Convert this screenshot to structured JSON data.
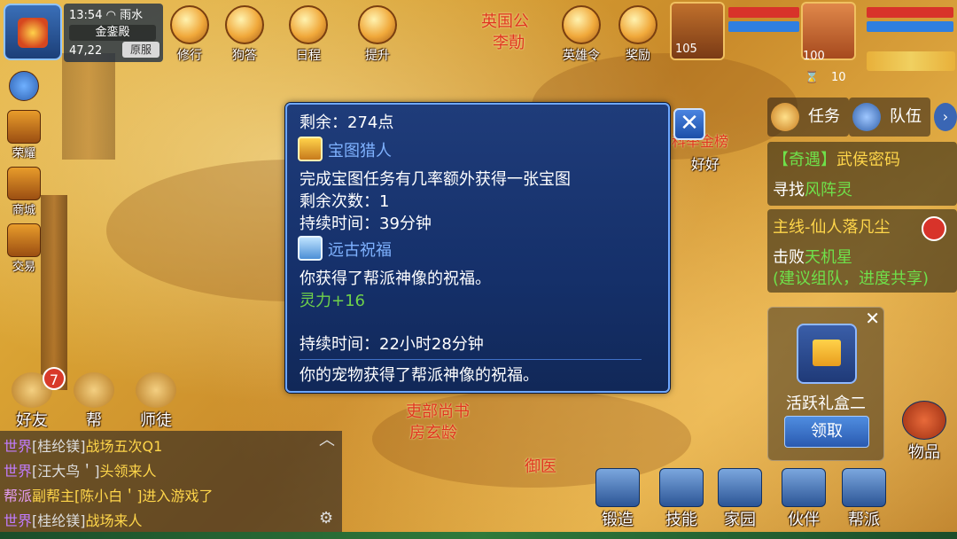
{
  "status": {
    "time": "13:54",
    "weather": "雨水",
    "location": "金銮殿",
    "coords": "47,22",
    "channel": "原服"
  },
  "top_icons": [
    {
      "label": "修行",
      "icon": "cultivate-icon"
    },
    {
      "label": "狗答",
      "icon": "quiz-icon"
    },
    {
      "label": "日程",
      "icon": "calendar-icon"
    },
    {
      "label": "提升",
      "icon": "upgrade-icon"
    },
    {
      "label": "英雄令",
      "icon": "hero-token-icon"
    },
    {
      "label": "奖励",
      "icon": "reward-icon"
    }
  ],
  "npc_top": {
    "title": "英国公",
    "name": "李勣"
  },
  "player": {
    "pet_level": "105",
    "char_level": "100",
    "queue_count": "10"
  },
  "side_menu": [
    {
      "label": "荣耀",
      "icon": "honor-icon"
    },
    {
      "label": "商城",
      "icon": "shop-icon"
    },
    {
      "label": "交易",
      "icon": "trade-icon"
    }
  ],
  "popup": {
    "remaining_points": "剩余：274点",
    "buff1": {
      "name": "宝图猎人",
      "desc": "完成宝图任务有几率额外获得一张宝图",
      "count": "剩余次数：1",
      "duration": "持续时间：39分钟"
    },
    "buff2": {
      "name": "远古祝福",
      "desc": "你获得了帮派神像的祝福。",
      "bonus": "灵力+16",
      "duration": "持续时间：22小时28分钟"
    },
    "pet_note": "你的宠物获得了帮派神像的祝福。",
    "close_label": "✕"
  },
  "background_text": {
    "exam": "科举金榜",
    "nearby": "好好"
  },
  "quest_tabs": [
    {
      "label": "任务",
      "icon": "quest-icon"
    },
    {
      "label": "队伍",
      "icon": "team-icon"
    }
  ],
  "quests": [
    {
      "type": "【奇遇】",
      "title": "武侯密码",
      "action": "寻找",
      "target": "风阵灵"
    },
    {
      "type": "主线-",
      "title": "仙人落凡尘",
      "action": "击败",
      "target": "天机星",
      "hint": "(建议组队，进度共享)"
    }
  ],
  "gift": {
    "title": "活跃礼盒二",
    "claim": "领取",
    "close": "✕"
  },
  "social": [
    {
      "label": "好友",
      "icon": "friends-icon",
      "badge": "7"
    },
    {
      "label": "帮",
      "icon": "voice-icon"
    },
    {
      "label": "师徒",
      "icon": "mentor-icon"
    }
  ],
  "chat": [
    {
      "channel": "世界",
      "user": "[桂纶镁]",
      "text": "战场五次Q1"
    },
    {
      "channel": "世界",
      "user": "[汪大鸟＇]",
      "text": "头领来人"
    },
    {
      "channel": "帮派",
      "user": "副帮主",
      "target": "[陈小白＇]",
      "text": "进入游戏了"
    },
    {
      "channel": "世界",
      "user": "[桂纶镁]",
      "text": "战场来人"
    }
  ],
  "npcs": [
    {
      "title": "吏部尚书",
      "name": "房玄龄"
    },
    {
      "title": "",
      "name": "御医"
    }
  ],
  "bottom_menu": [
    {
      "label": "锻造",
      "icon": "forge-icon"
    },
    {
      "label": "技能",
      "icon": "skill-icon"
    },
    {
      "label": "家园",
      "icon": "home-icon"
    },
    {
      "label": "伙伴",
      "icon": "partner-icon"
    },
    {
      "label": "帮派",
      "icon": "guild-icon"
    },
    {
      "label": "物品",
      "icon": "bag-icon"
    }
  ]
}
